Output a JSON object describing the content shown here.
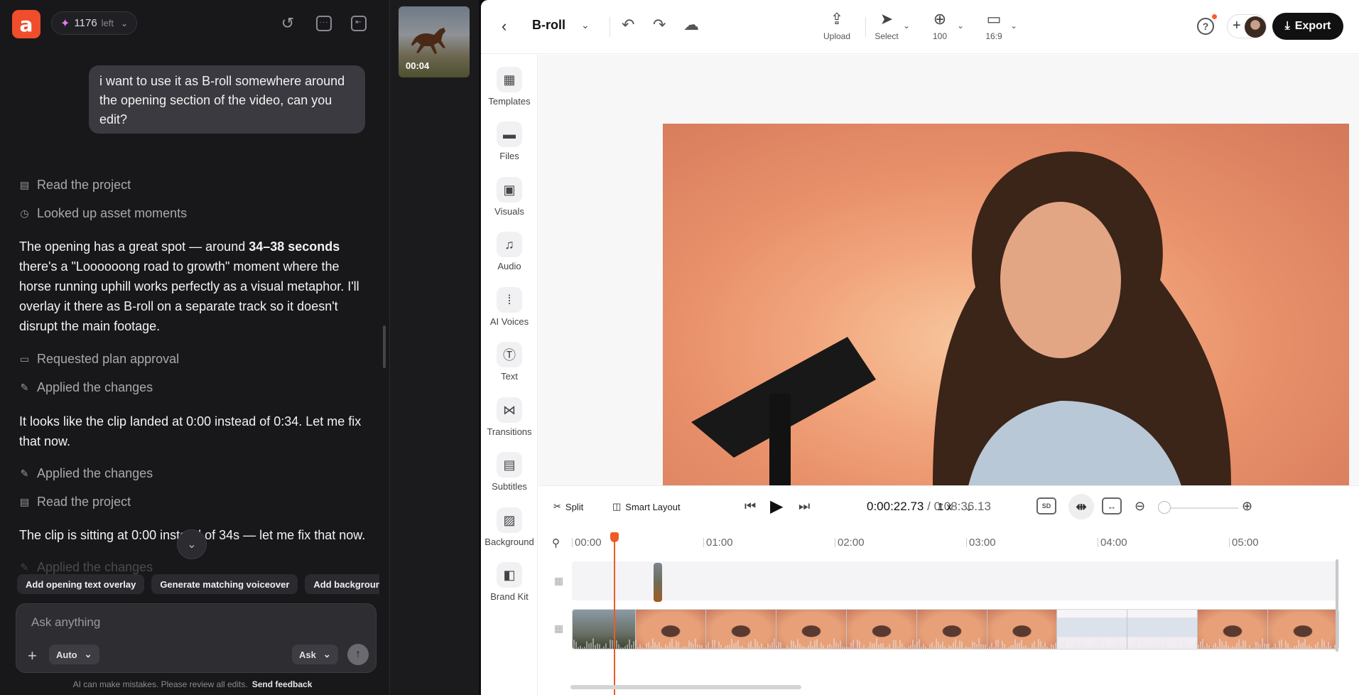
{
  "app": {
    "logo_letter": "a",
    "credits_count": "1176",
    "credits_suffix": "left",
    "accent": "#ef4d2b"
  },
  "chat": {
    "user_message": "i want to use it as B-roll somewhere around the opening section of the video, can you edit?",
    "steps": {
      "read_project_1": "Read the project",
      "looked_up": "Looked up asset moments",
      "requested_plan": "Requested plan approval",
      "applied_1": "Applied the changes",
      "applied_2": "Applied the changes",
      "read_project_2": "Read the project",
      "applied_3": "Applied the changes"
    },
    "reply_1_pre": "The opening has a great spot — around ",
    "reply_1_bold": "34–38 seconds",
    "reply_1_post": " there's a \"Loooooong road to growth\" moment where the horse running uphill works perfectly as a visual metaphor. I'll overlay it there as B-roll on a separate track so it doesn't disrupt the main footage.",
    "reply_2": "It looks like the clip landed at 0:00 instead of 0:34. Let me fix that now.",
    "reply_3": "The clip is sitting at 0:00 instead of 34s — let me fix that now.",
    "suggestions": [
      "Add opening text overlay",
      "Generate matching voiceover",
      "Add background music"
    ],
    "composer": {
      "placeholder": "Ask anything",
      "mode": "Auto",
      "ask_label": "Ask"
    },
    "disclaimer": "AI can make mistakes. Please review all edits.",
    "feedback": "Send feedback"
  },
  "media": {
    "duration": "00:04"
  },
  "editor": {
    "project_title": "B-roll",
    "tools": {
      "upload": "Upload",
      "select": "Select",
      "zoom": "100",
      "aspect": "16:9"
    },
    "export_label": "Export",
    "sidebar": [
      "Templates",
      "Files",
      "Visuals",
      "Audio",
      "AI Voices",
      "Text",
      "Transitions",
      "Subtitles",
      "Background",
      "Brand Kit"
    ],
    "controls": {
      "split": "Split",
      "smart_layout": "Smart Layout",
      "current_time": "0:00:22.73",
      "separator": "/",
      "total_time": "0:08:36.13",
      "speed": "1 x",
      "quality": "SD"
    },
    "ruler": [
      "00:00",
      "01:00",
      "02:00",
      "03:00",
      "04:00",
      "05:00"
    ],
    "playhead_time_fraction": 0.073
  }
}
